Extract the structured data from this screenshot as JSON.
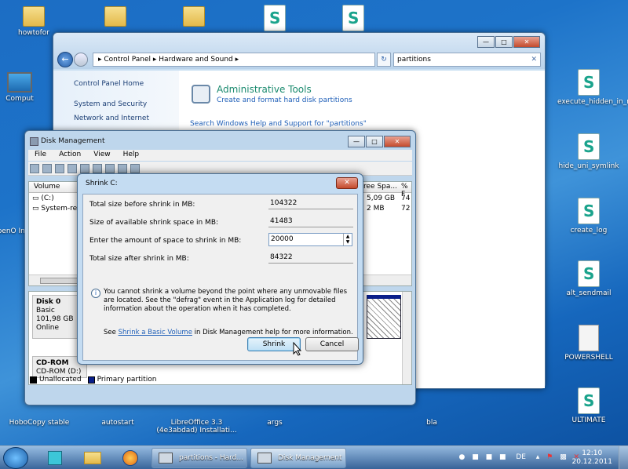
{
  "desktop": {
    "icons_top": [
      "howtofor",
      "",
      "",
      "",
      ""
    ],
    "icons_left": [
      "Comput",
      "OpenO Ins"
    ],
    "icons_right": [
      "execute_hidden_in_reg",
      "hide_uni_symlink",
      "create_log",
      "alt_sendmail",
      "POWERSHELL",
      "ULTIMATE"
    ],
    "icons_bottom": [
      "HoboCopy stable",
      "autostart",
      "LibreOffice 3.3 (4e3abdad) Installati...",
      "args",
      "bla"
    ]
  },
  "control_panel": {
    "address": "▸ Control Panel  ▸ Hardware and Sound  ▸",
    "search_value": "partitions",
    "sidebar": [
      "Control Panel Home",
      "System and Security",
      "Network and Internet"
    ],
    "admin_title": "Administrative Tools",
    "admin_link": "Create and format hard disk partitions",
    "help_link": "Search Windows Help and Support for \"partitions\""
  },
  "disk_mgmt": {
    "title": "Disk Management",
    "menu": [
      "File",
      "Action",
      "View",
      "Help"
    ],
    "columns": {
      "volume": "Volume",
      "free": "ree Spa...",
      "pct": "% F"
    },
    "rows": [
      {
        "volume": "(C:)",
        "free": "5,09 GB",
        "pct": "74"
      },
      {
        "volume": "System-res",
        "free": "2 MB",
        "pct": "72"
      }
    ],
    "disk0": {
      "name": "Disk 0",
      "type": "Basic",
      "size": "101,98 GB",
      "status": "Online"
    },
    "cdrom": {
      "name": "CD-ROM",
      "drive": "CD-ROM (D:)"
    },
    "legend": [
      "Unallocated",
      "Primary partition"
    ],
    "colors": {
      "unallocated": "#000000",
      "primary": "#0a1f8a"
    }
  },
  "shrink": {
    "title": "Shrink C:",
    "labels": {
      "before": "Total size before shrink in MB:",
      "available": "Size of available shrink space in MB:",
      "amount": "Enter the amount of space to shrink in MB:",
      "after": "Total size after shrink in MB:"
    },
    "values": {
      "before": "104322",
      "available": "41483",
      "amount": "20000",
      "after": "84322"
    },
    "info": "You cannot shrink a volume beyond the point where any unmovable files are located. See the \"defrag\" event in the Application log for detailed information about the operation when it has completed.",
    "see_prefix": "See",
    "see_link": "Shrink a Basic Volume",
    "see_suffix": "in Disk Management help for more information.",
    "shrink_btn": "Shrink",
    "cancel_btn": "Cancel"
  },
  "taskbar": {
    "items": [
      "partitions - Hard...",
      "Disk Management"
    ],
    "lang": "DE",
    "time": "12:10",
    "date": "20.12.2011"
  }
}
